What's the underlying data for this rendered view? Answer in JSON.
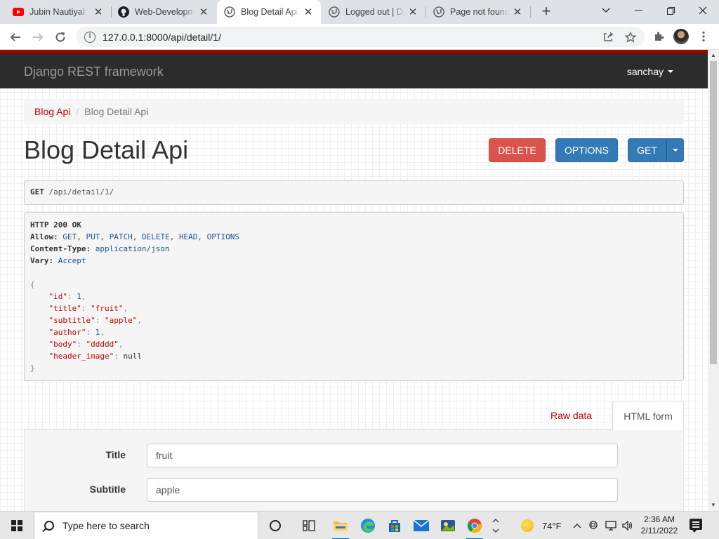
{
  "browser": {
    "tabs": [
      {
        "title": "Jubin Nautiyal: M",
        "icon": "youtube-icon"
      },
      {
        "title": "Web-Developme",
        "icon": "github-icon"
      },
      {
        "title": "Blog Detail Api -",
        "icon": "globe-icon",
        "active": true
      },
      {
        "title": "Logged out | Dja",
        "icon": "globe-icon"
      },
      {
        "title": "Page not found",
        "icon": "globe-icon"
      }
    ],
    "url": "127.0.0.1:8000/api/detail/1/"
  },
  "drf": {
    "brand": "Django REST framework",
    "user": "sanchay",
    "breadcrumb": {
      "parent": "Blog Api",
      "current": "Blog Detail Api"
    },
    "page_title": "Blog Detail Api",
    "buttons": {
      "delete": "DELETE",
      "options": "OPTIONS",
      "get": "GET"
    },
    "request": {
      "method": "GET",
      "path": "/api/detail/1/"
    },
    "response": {
      "status": "HTTP 200 OK",
      "headers": [
        {
          "name": "Allow:",
          "value": "GET, PUT, PATCH, DELETE, HEAD, OPTIONS"
        },
        {
          "name": "Content-Type:",
          "value": "application/json"
        },
        {
          "name": "Vary:",
          "value": "Accept"
        }
      ],
      "open_brace": "{",
      "close_brace": "}",
      "body": [
        {
          "key": "\"id\"",
          "value": "1",
          "type": "num",
          "comma": ","
        },
        {
          "key": "\"title\"",
          "value": "\"fruit\"",
          "type": "str",
          "comma": ","
        },
        {
          "key": "\"subtitle\"",
          "value": "\"apple\"",
          "type": "str",
          "comma": ","
        },
        {
          "key": "\"author\"",
          "value": "1",
          "type": "num",
          "comma": ","
        },
        {
          "key": "\"body\"",
          "value": "\"ddddd\"",
          "type": "str",
          "comma": ","
        },
        {
          "key": "\"header_image\"",
          "value": "null",
          "type": "lit",
          "comma": ""
        }
      ]
    },
    "form_tabs": {
      "raw": "Raw data",
      "html": "HTML form"
    },
    "form": {
      "title_label": "Title",
      "title_value": "fruit",
      "subtitle_label": "Subtitle",
      "subtitle_value": "apple"
    }
  },
  "taskbar": {
    "search_placeholder": "Type here to search",
    "weather": "74°F",
    "time": "2:36 AM",
    "date": "2/11/2022"
  },
  "colors": {
    "drf_red": "#a30000",
    "link_red": "#c20000",
    "danger": "#d9534f",
    "primary": "#337ab7"
  }
}
